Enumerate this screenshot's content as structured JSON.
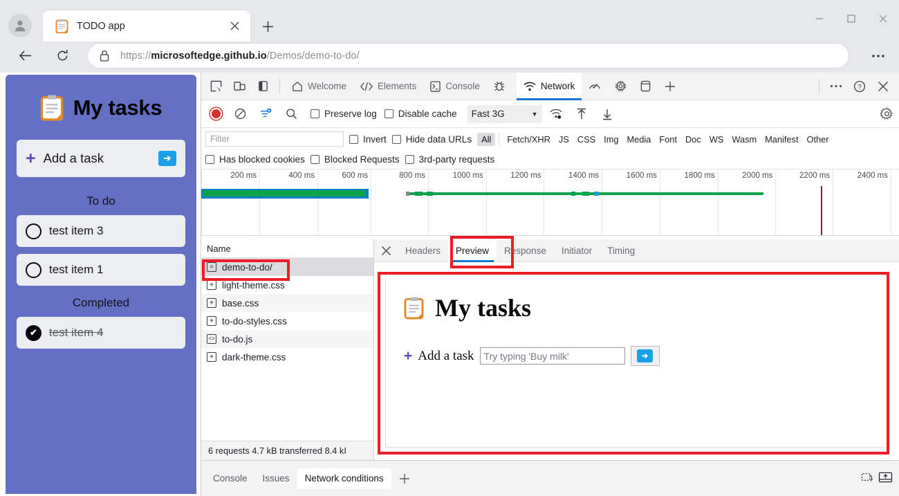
{
  "browser": {
    "tab": {
      "title": "TODO app",
      "favicon": "clipboard-icon",
      "close": "×"
    },
    "new_tab": "+",
    "back": "←",
    "reload": "⟳",
    "url_secure_prefix": "https://",
    "url_domain": "microsoftedge.github.io",
    "url_path": "/Demos/demo-to-do/",
    "settings_more": "⋯",
    "window_controls": {
      "minimize": "–",
      "maximize": "□",
      "close": "✕"
    }
  },
  "todo_app": {
    "title": "My tasks",
    "add_task_label": "Add a task",
    "go_button": "➔",
    "sections": [
      {
        "label": "To do",
        "items": [
          {
            "text": "test item 3",
            "done": false
          },
          {
            "text": "test item 1",
            "done": false
          }
        ]
      },
      {
        "label": "Completed",
        "items": [
          {
            "text": "test item 4",
            "done": true
          }
        ]
      }
    ],
    "check_glyph": "✔",
    "accent_bg": "#6370c4",
    "accent_plus": "#5a4bc0",
    "go_blue": "#19a0e8"
  },
  "devtools": {
    "left_icons": [
      "inspect-element-icon",
      "device-toolbar-icon",
      "dock-side-icon"
    ],
    "panels": [
      {
        "label": "Welcome",
        "icon": "home-icon",
        "active": false
      },
      {
        "label": "Elements",
        "icon": "code-brackets-icon",
        "active": false
      },
      {
        "label": "Console",
        "icon": "console-prompt-icon",
        "active": false
      },
      {
        "label": "",
        "icon": "bug-icon",
        "active": false
      },
      {
        "label": "Network",
        "icon": "network-wifi-icon",
        "active": true
      },
      {
        "label": "",
        "icon": "performance-icon",
        "active": false
      },
      {
        "label": "",
        "icon": "memory-chip-icon",
        "active": false
      },
      {
        "label": "",
        "icon": "application-storage-icon",
        "active": false
      },
      {
        "label": "",
        "icon": "add-panel-icon",
        "active": false
      }
    ],
    "toolbar_right": {
      "more": "⋯",
      "help": "?",
      "close": "✕"
    },
    "network_toolbar": {
      "record": "record-button",
      "clear": "clear-button",
      "filter_toggle": "search-filter-toggle",
      "search": "search-icon",
      "preserve_log": "Preserve log",
      "disable_cache": "Disable cache",
      "throttle_value": "Fast 3G",
      "throttle_caret": "▼",
      "online_icon": "network-conditions-icon",
      "import_har": "import-har-icon",
      "export_har": "export-har-icon",
      "settings": "gear-icon"
    },
    "filter_bar": {
      "filter_placeholder": "Filter",
      "invert": "Invert",
      "hide_data_urls": "Hide data URLs",
      "resource_types": [
        "All",
        "Fetch/XHR",
        "JS",
        "CSS",
        "Img",
        "Media",
        "Font",
        "Doc",
        "WS",
        "Wasm",
        "Manifest",
        "Other"
      ],
      "selected_resource_type": "All",
      "has_blocked_cookies": "Has blocked cookies",
      "blocked_requests": "Blocked Requests",
      "third_party": "3rd-party requests"
    },
    "timeline": {
      "ticks": [
        "200 ms",
        "400 ms",
        "600 ms",
        "800 ms",
        "1000 ms",
        "1200 ms",
        "1400 ms",
        "1600 ms",
        "1800 ms",
        "2000 ms",
        "2200 ms",
        "2400 ms"
      ],
      "bars": [
        {
          "start_pct": 0,
          "width_pct": 24.0,
          "color": "#0f7fc4"
        },
        {
          "start_pct": 0.4,
          "width_pct": 23.2,
          "color": "#0ca14b"
        },
        {
          "start_pct": 29.5,
          "width_pct": 51.0,
          "color": "#0ca14b"
        }
      ],
      "event_marker_pct": 88.8,
      "event_marker_color": "#9e1038"
    },
    "requests": {
      "column_header": "Name",
      "rows": [
        {
          "name": "demo-to-do/",
          "icon": "document-icon",
          "selected": true
        },
        {
          "name": "light-theme.css",
          "icon": "stylesheet-icon",
          "selected": false
        },
        {
          "name": "base.css",
          "icon": "stylesheet-icon",
          "selected": false
        },
        {
          "name": "to-do-styles.css",
          "icon": "stylesheet-icon",
          "selected": false
        },
        {
          "name": "to-do.js",
          "icon": "script-icon",
          "selected": false
        },
        {
          "name": "dark-theme.css",
          "icon": "stylesheet-icon",
          "selected": false
        }
      ],
      "status": "6 requests  4.7 kB transferred  8.4 kI"
    },
    "detail": {
      "close": "✕",
      "tabs": [
        "Headers",
        "Preview",
        "Response",
        "Initiator",
        "Timing"
      ],
      "active_tab": "Preview",
      "preview": {
        "title": "My tasks",
        "add_task_label": "Add a task",
        "input_placeholder": "Try typing 'Buy milk'",
        "go_button": "➔"
      }
    },
    "drawer": {
      "tabs": [
        "Console",
        "Issues",
        "Network conditions"
      ],
      "active_tab": "Network conditions",
      "add": "+",
      "right_icons": [
        "restore-drawer-icon",
        "dock-bottom-icon"
      ]
    }
  },
  "annotations": {
    "color": "#ee1c25",
    "boxes": [
      "request-row-highlight",
      "preview-tab-highlight",
      "preview-panel-highlight"
    ]
  }
}
